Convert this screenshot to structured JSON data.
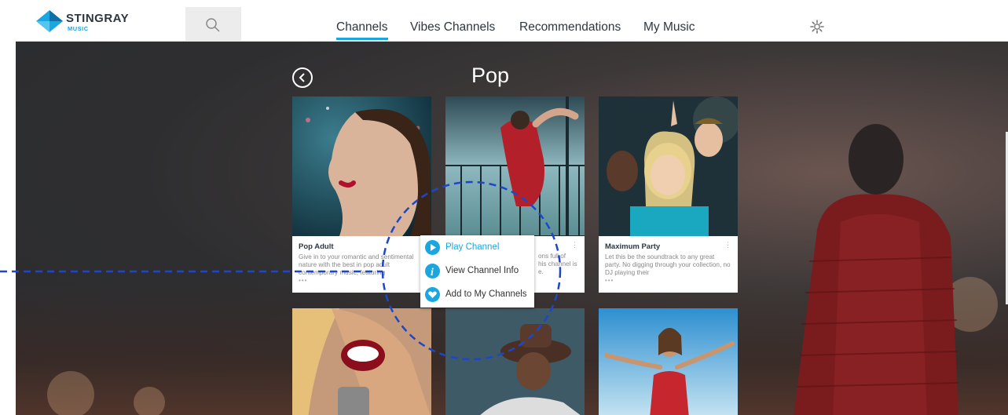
{
  "logo": {
    "word": "STINGRAY",
    "sub": "MUSIC"
  },
  "nav": {
    "tabs": [
      "Channels",
      "Vibes Channels",
      "Recommendations",
      "My Music"
    ],
    "active_index": 0
  },
  "page": {
    "title": "Pop"
  },
  "cards": [
    {
      "title": "Pop Adult",
      "desc": "Give in to your romantic and sentimental nature with the best in pop adult contemporary music, featuring",
      "dots": "•••"
    },
    {
      "title": "",
      "desc": "...ons full of ...his channel is ...e.",
      "dots": ""
    },
    {
      "title": "Maximum Party",
      "desc": "Let this be the soundtrack to any great party. No digging through your collection, no DJ playing their",
      "dots": "•••"
    }
  ],
  "card2_fragment": {
    "line1": "ons full of",
    "line2": "his channel is",
    "line3": "e."
  },
  "context_menu": {
    "items": [
      {
        "label": "Play Channel",
        "icon": "play-icon"
      },
      {
        "label": "View Channel Info",
        "icon": "info-icon"
      },
      {
        "label": "Add to My Channels",
        "icon": "heart-icon"
      }
    ]
  },
  "icons": {
    "search": "search-icon",
    "settings": "gear-icon",
    "back": "chevron-left-icon"
  },
  "colors": {
    "accent": "#1aa7e0",
    "annotation": "#1e46c8",
    "text_dark": "#2d3640"
  }
}
